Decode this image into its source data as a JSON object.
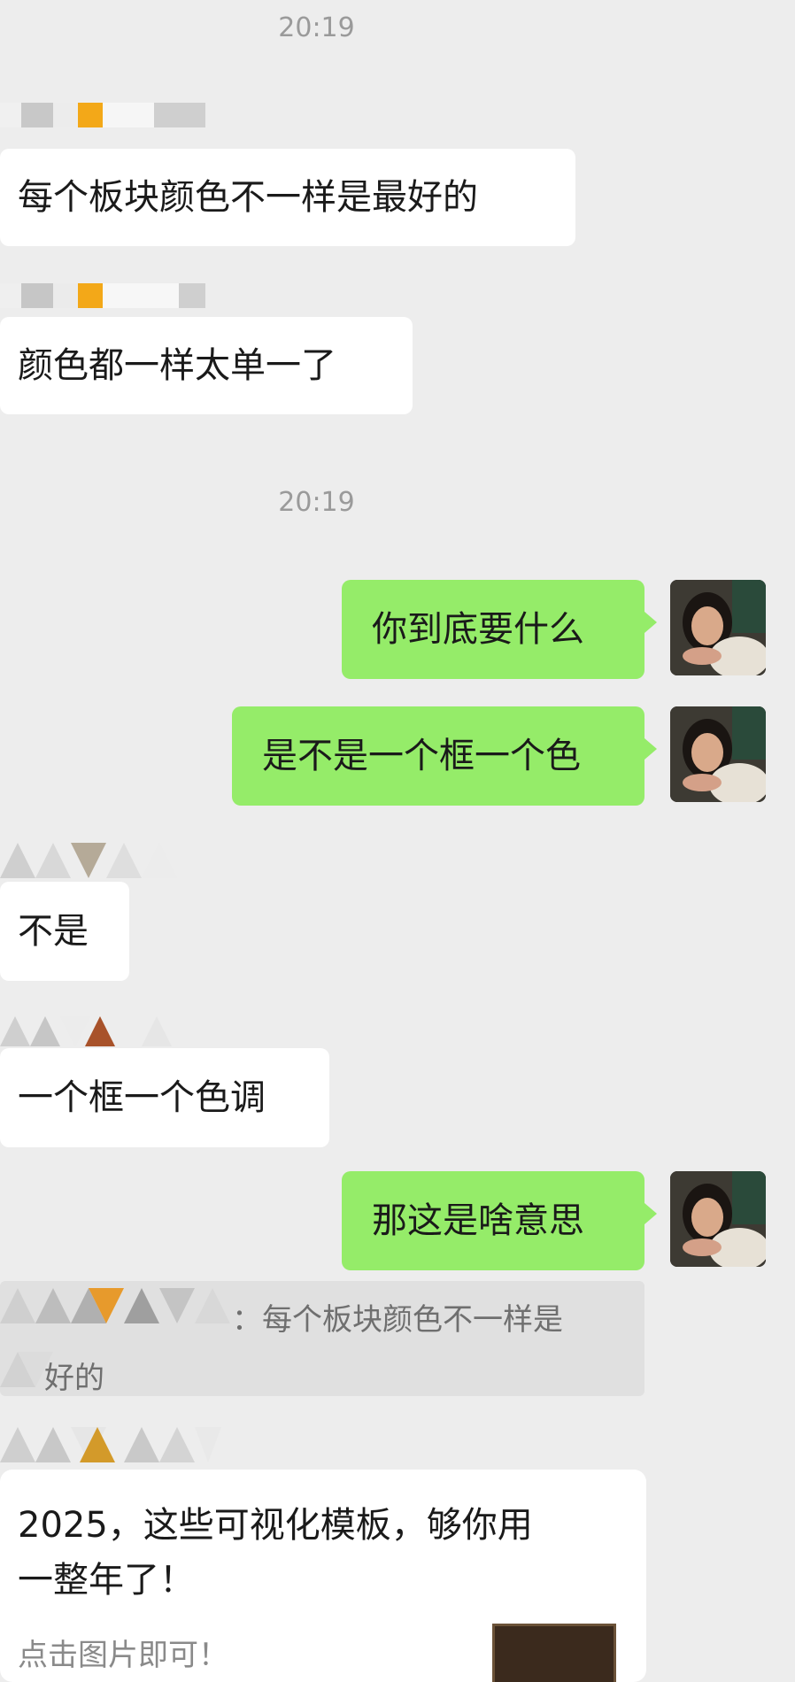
{
  "timestamps": [
    "20:19",
    "20:19"
  ],
  "messages": {
    "m1": "每个板块颜色不一样是最好的",
    "m2": "颜色都一样太单一了",
    "m3": "你到底要什么",
    "m4": "是不是一个框一个色",
    "m5": "不是",
    "m6": "一个框一个色调",
    "m7": "那这是啥意思"
  },
  "quote": {
    "line1": "：每个板块颜色不一样是",
    "line2": "好的"
  },
  "card": {
    "title_line1": "2025，这些可视化模板，够你用",
    "title_line2": "一整年了！",
    "subtitle": "点击图片即可！"
  },
  "colors": {
    "background": "#ededed",
    "sent_bubble": "#95ec69",
    "received_bubble": "#ffffff",
    "timestamp": "#9a9a9a"
  }
}
